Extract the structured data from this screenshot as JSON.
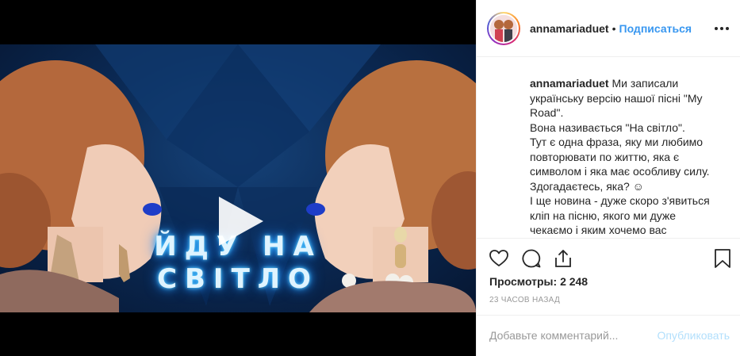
{
  "post": {
    "username": "annamariaduet",
    "follow_label": "Подписаться",
    "separator": "•",
    "video_text": {
      "line1": "ЙДУ НА",
      "line2": "СВІТЛО"
    },
    "caption": {
      "username": "annamariaduet",
      "lines": [
        "Ми записали",
        "українську версію нашої пісні \"My",
        "Road\".",
        "Вона називається \"На світло\".",
        "Тут є одна фраза, яку ми любимо",
        "повторювати по життю, яка є",
        "символом і яка має особливу силу.",
        "Здогадаєтесь, яка? ☺",
        "І ще новина - дуже скоро з'явиться",
        "кліп на пісню, якого ми дуже",
        "чекаємо і яким хочемо вас"
      ]
    },
    "views_label": "Просмотры:",
    "views_count": "2 248",
    "timestamp": "23 ЧАСОВ НАЗАД",
    "comment": {
      "placeholder": "Добавьте комментарий...",
      "publish_label": "Опубликовать"
    }
  },
  "icons": {
    "play": "play-icon",
    "more": "more-options-icon",
    "like": "heart-icon",
    "comment": "comment-icon",
    "share": "share-icon",
    "save": "bookmark-icon"
  },
  "colors": {
    "link_blue": "#3897f0",
    "publish_disabled": "#b2dffc",
    "border": "#efefef",
    "muted": "#999999",
    "video_bg": "#0b2a55",
    "neon_text": "#dff4ff"
  }
}
